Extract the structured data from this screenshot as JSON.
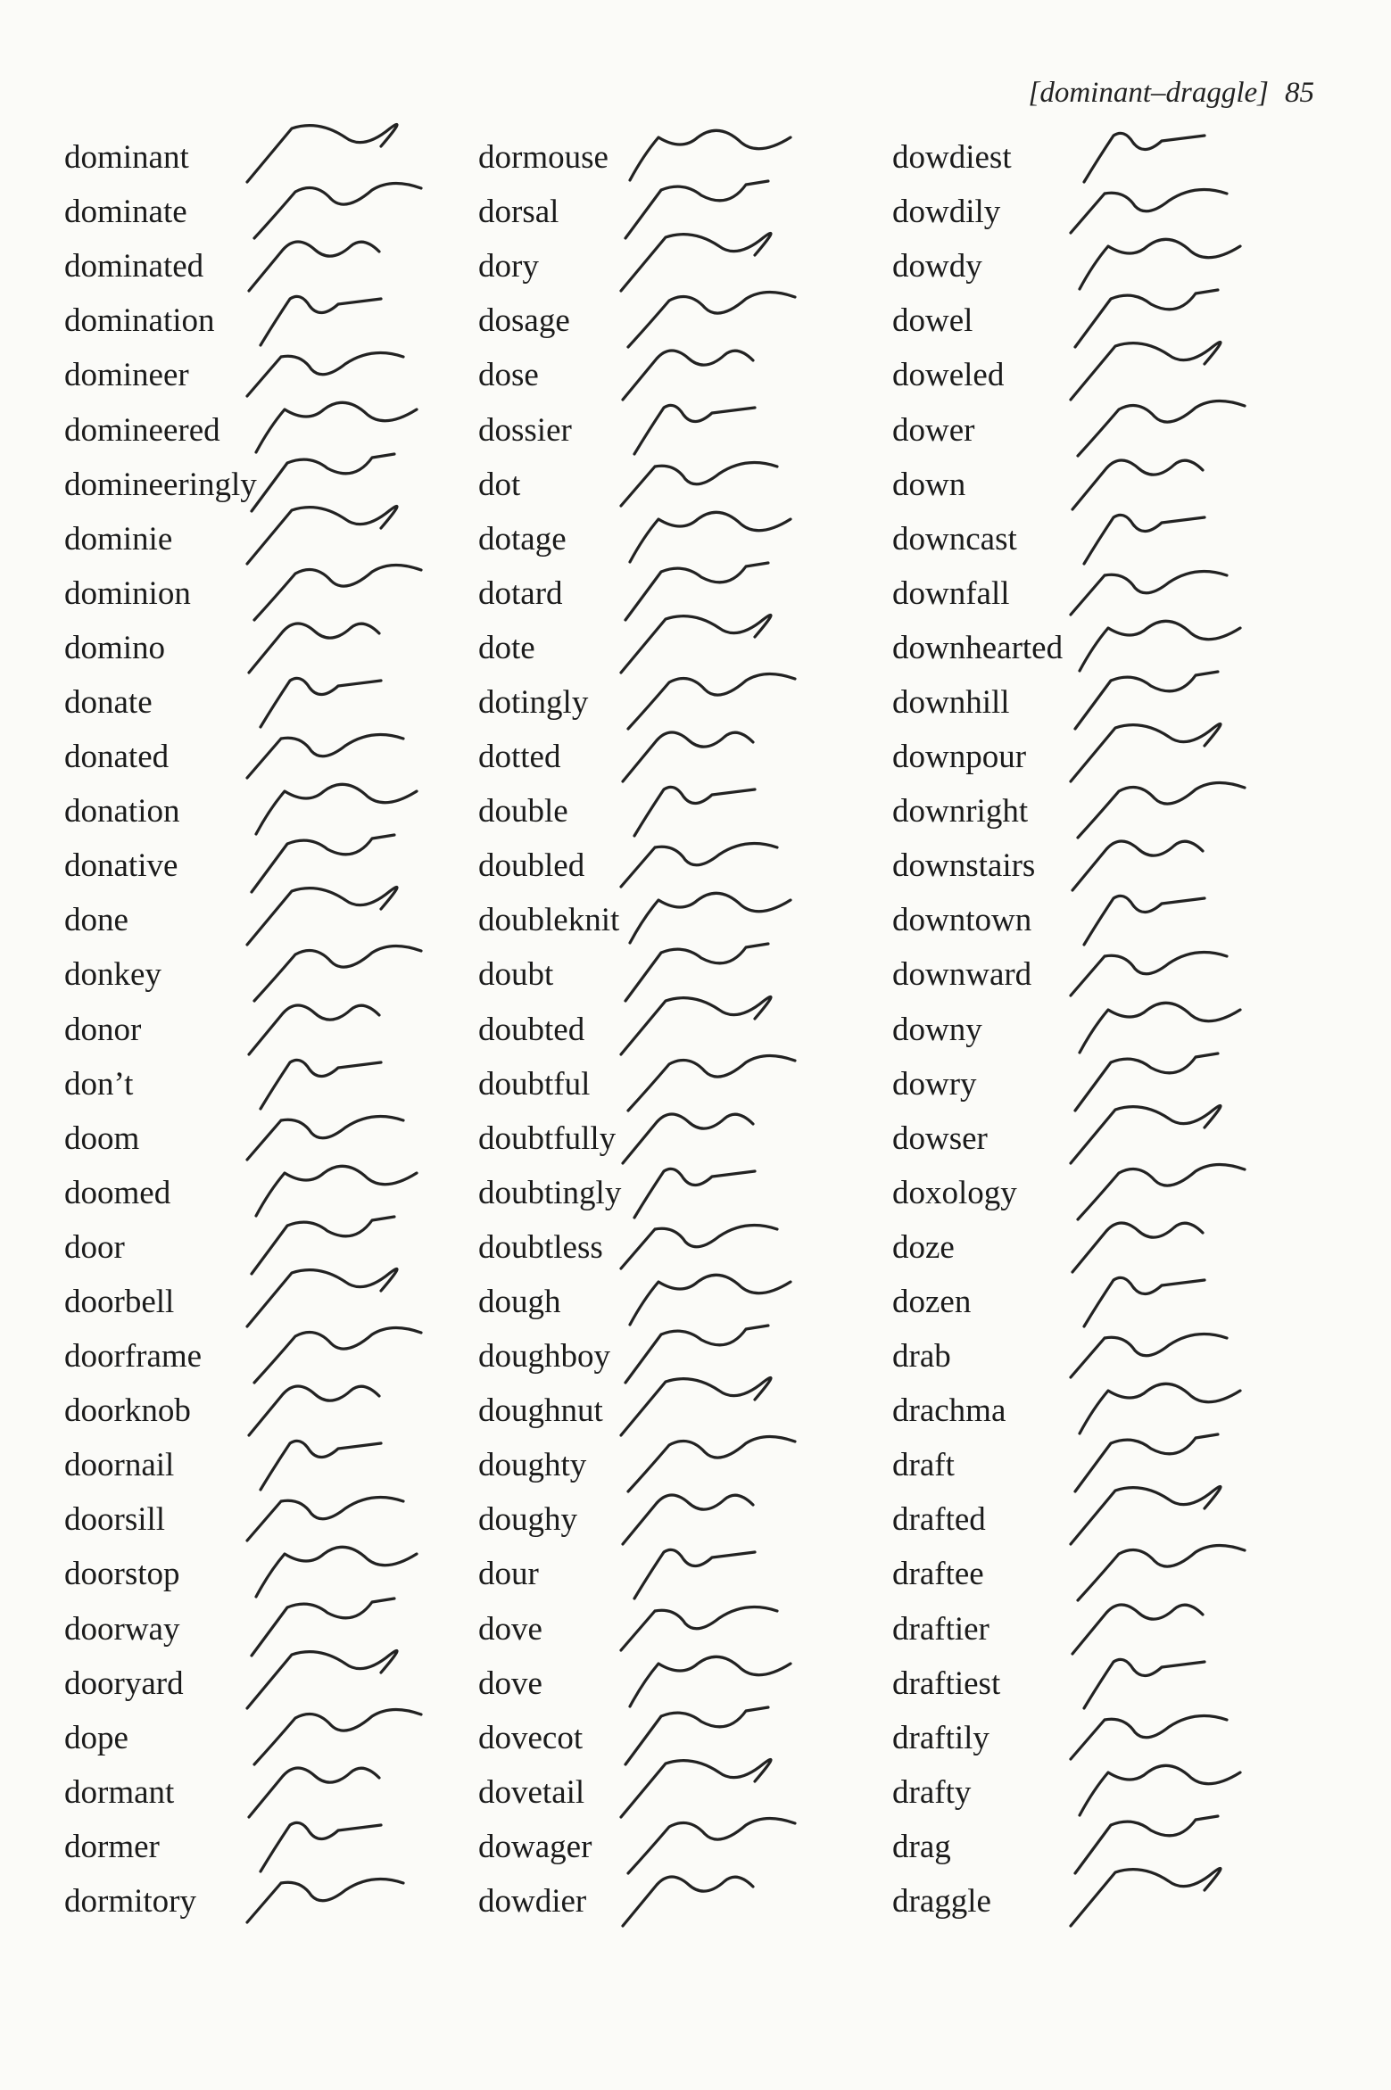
{
  "header": {
    "range": "[dominant–draggle]",
    "page_number": "85"
  },
  "columns": [
    {
      "words": [
        "dominant",
        "dominate",
        "dominated",
        "domination",
        "domineer",
        "domineered",
        "domineeringly",
        "dominie",
        "dominion",
        "domino",
        "donate",
        "donated",
        "donation",
        "donative",
        "done",
        "donkey",
        "donor",
        "don’t",
        "doom",
        "doomed",
        "door",
        "doorbell",
        "doorframe",
        "doorknob",
        "doornail",
        "doorsill",
        "doorstop",
        "doorway",
        "dooryard",
        "dope",
        "dormant",
        "dormer",
        "dormitory"
      ]
    },
    {
      "words": [
        "dormouse",
        "dorsal",
        "dory",
        "dosage",
        "dose",
        "dossier",
        "dot",
        "dotage",
        "dotard",
        "dote",
        "dotingly",
        "dotted",
        "double",
        "doubled",
        "doubleknit",
        "doubt",
        "doubted",
        "doubtful",
        "doubtfully",
        "doubtingly",
        "doubtless",
        "dough",
        "doughboy",
        "doughnut",
        "doughty",
        "doughy",
        "dour",
        "dove",
        "dove",
        "dovecot",
        "dovetail",
        "dowager",
        "dowdier"
      ]
    },
    {
      "words": [
        "dowdiest",
        "dowdily",
        "dowdy",
        "dowel",
        "doweled",
        "dower",
        "down",
        "downcast",
        "downfall",
        "downhearted",
        "downhill",
        "downpour",
        "downright",
        "downstairs",
        "downtown",
        "downward",
        "downy",
        "dowry",
        "dowser",
        "doxology",
        "doze",
        "dozen",
        "drab",
        "drachma",
        "draft",
        "drafted",
        "draftee",
        "draftier",
        "draftiest",
        "draftily",
        "drafty",
        "drag",
        "draggle"
      ]
    }
  ]
}
